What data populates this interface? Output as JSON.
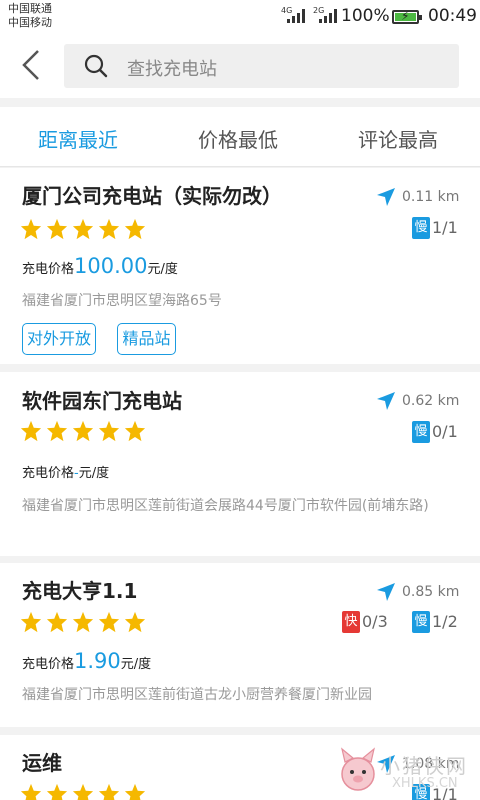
{
  "status_bar": {
    "carrier1": "中国联通",
    "carrier2": "中国移动",
    "net1": "4G",
    "net2": "2G",
    "battery": "100%",
    "time": "00:49"
  },
  "header": {
    "search_placeholder": "查找充电站"
  },
  "tabs": [
    "距离最近",
    "价格最低",
    "评论最高"
  ],
  "price_label": "充电价格",
  "price_unit": "元/度",
  "stations": [
    {
      "name": "厦门公司充电站（实际勿改）",
      "distance": "0.11 km",
      "rating": 5,
      "slow_label": "慢",
      "slow_count": "1/1",
      "price": "100.00",
      "address": "福建省厦门市思明区望海路65号",
      "tags": [
        "对外开放",
        "精品站"
      ]
    },
    {
      "name": "软件园东门充电站",
      "distance": "0.62 km",
      "rating": 5,
      "slow_label": "慢",
      "slow_count": "0/1",
      "price": "-",
      "address": "福建省厦门市思明区莲前街道会展路44号厦门市软件园(前埔东路)"
    },
    {
      "name": "充电大亨1.1",
      "distance": "0.85 km",
      "rating": 5,
      "fast_label": "快",
      "fast_count": "0/3",
      "slow_label": "慢",
      "slow_count": "1/2",
      "price": "1.90",
      "address": "福建省厦门市思明区莲前街道古龙小厨营养餐厦门新业园"
    },
    {
      "name": "运维",
      "distance": "1.08 km",
      "rating": 5,
      "slow_label": "慢",
      "slow_count": "1/1"
    }
  ],
  "watermark": {
    "text": "小猪侠网",
    "sub": "XHLKS.CN"
  },
  "colors": {
    "accent": "#1a9be0",
    "star": "#f5b800",
    "fast": "#e53935"
  }
}
